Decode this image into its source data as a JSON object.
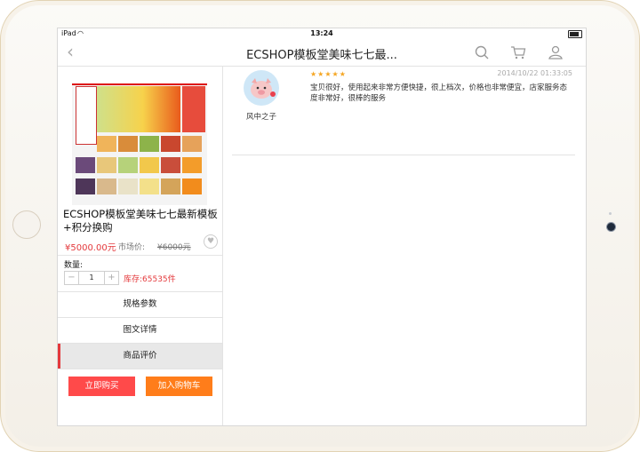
{
  "status_bar": {
    "device": "iPad",
    "time": "13:24"
  },
  "nav": {
    "title": "ECSHOP模板堂美味七七最..."
  },
  "product": {
    "title": "ECSHOP模板堂美味七七最新模板+积分换购",
    "price": "¥5000.00元",
    "market_price_label": "市场价:",
    "market_price": "¥6000元",
    "quantity_label": "数量:",
    "quantity": "1",
    "stock": "库存:65535件"
  },
  "tabs": [
    {
      "label": "规格参数",
      "active": false
    },
    {
      "label": "图文详情",
      "active": false
    },
    {
      "label": "商品评价",
      "active": true
    }
  ],
  "actions": {
    "buy_now": "立即购买",
    "add_to_cart": "加入购物车"
  },
  "review": {
    "user": "风中之子",
    "rating": 5,
    "stars_text": "★★★★★",
    "date": "2014/10/22 01:33:05",
    "text": "宝贝很好，使用起来非常方便快捷，很上档次，价格也非常便宜，店家服务态度非常好，很棒的服务"
  },
  "colors": {
    "accent": "#e4393c",
    "buy": "#ff4a4a",
    "cart": "#ff7d1a",
    "star": "#f5a623"
  }
}
